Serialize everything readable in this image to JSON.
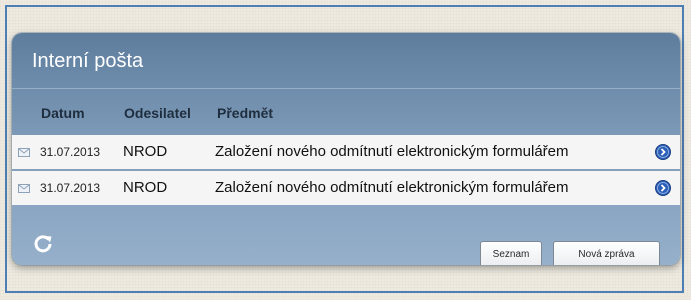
{
  "panel": {
    "title": "Interní pošta"
  },
  "columns": {
    "date": "Datum",
    "sender": "Odesilatel",
    "subject": "Předmět"
  },
  "messages": [
    {
      "date": "31.07.2013",
      "sender": "NROD",
      "subject": "Založení nového odmítnutí elektronickým formulářem"
    },
    {
      "date": "31.07.2013",
      "sender": "NROD",
      "subject": "Založení nového odmítnutí elektronickým formulářem"
    }
  ],
  "actions": {
    "list_label": "Seznam",
    "new_message_label": "Nová zpráva"
  },
  "colors": {
    "panel_top": "#5e7d9d",
    "panel_bottom": "#96b0cb",
    "frame_border": "#4d7fb5",
    "open_icon": "#2b5fb7"
  },
  "icons": {
    "row_icon": "envelope-icon",
    "open_icon": "open-message-icon",
    "refresh_icon": "refresh-icon"
  }
}
